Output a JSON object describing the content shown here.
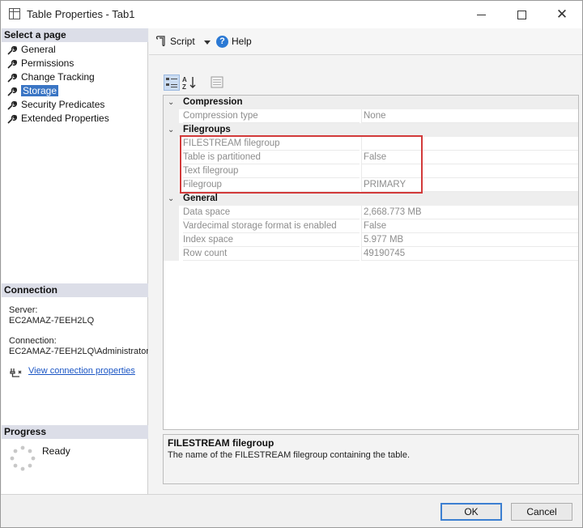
{
  "window": {
    "title": "Table Properties - Tab1"
  },
  "left_panel": {
    "select_page_header": "Select a page",
    "pages": [
      {
        "label": "General"
      },
      {
        "label": "Permissions"
      },
      {
        "label": "Change Tracking"
      },
      {
        "label": "Storage"
      },
      {
        "label": "Security Predicates"
      },
      {
        "label": "Extended Properties"
      }
    ],
    "selected_page": "Storage",
    "connection": {
      "header": "Connection",
      "server_label": "Server:",
      "server_value": "EC2AMAZ-7EEH2LQ",
      "connection_label": "Connection:",
      "connection_value": "EC2AMAZ-7EEH2LQ\\Administrator",
      "link_label": "View connection properties"
    },
    "progress": {
      "header": "Progress",
      "status": "Ready"
    }
  },
  "toolbar": {
    "script_label": "Script",
    "help_label": "Help"
  },
  "property_grid": {
    "categories": [
      {
        "name": "Compression",
        "rows": [
          {
            "label": "Compression type",
            "value": "None"
          }
        ]
      },
      {
        "name": "Filegroups",
        "rows": [
          {
            "label": "FILESTREAM filegroup",
            "value": ""
          },
          {
            "label": "Table is partitioned",
            "value": "False"
          },
          {
            "label": "Text filegroup",
            "value": ""
          },
          {
            "label": "Filegroup",
            "value": "PRIMARY"
          }
        ]
      },
      {
        "name": "General",
        "rows": [
          {
            "label": "Data space",
            "value": "2,668.773 MB"
          },
          {
            "label": "Vardecimal storage format is enabled",
            "value": "False"
          },
          {
            "label": "Index space",
            "value": "5.977 MB"
          },
          {
            "label": "Row count",
            "value": "49190745"
          }
        ]
      }
    ]
  },
  "description": {
    "title": "FILESTREAM filegroup",
    "text": "The name of the FILESTREAM filegroup containing the table."
  },
  "buttons": {
    "ok": "OK",
    "cancel": "Cancel"
  },
  "colors": {
    "accent": "#3a75c4",
    "highlight_border": "#d23a3a",
    "header_bg": "#dcdee8"
  }
}
